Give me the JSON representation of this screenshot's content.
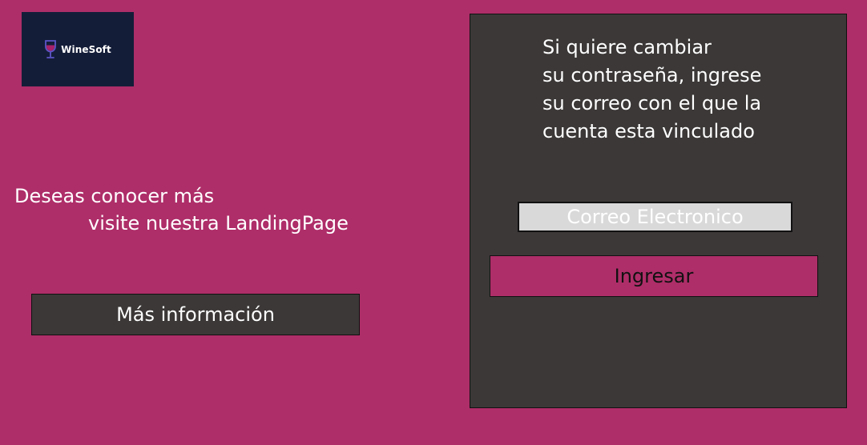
{
  "logo": {
    "text": "WineSoft",
    "icon": "wine-glass-icon"
  },
  "promo": {
    "line1": "Deseas conocer más",
    "line2": "visite nuestra LandingPage"
  },
  "more_button": {
    "label": "Más información"
  },
  "reset_panel": {
    "lines": [
      "Si quiere cambiar",
      "su contraseña, ingrese",
      "su correo con el que la",
      "cuenta esta vinculado"
    ],
    "email": {
      "placeholder": "Correo Electronico",
      "value": ""
    },
    "submit_label": "Ingresar"
  },
  "colors": {
    "background": "#ae2e69",
    "panel": "#3b3837",
    "logo_bg": "#141d38",
    "input_bg": "#d9d9d9",
    "wine": "#a8226b",
    "glass": "#5c56c8"
  }
}
